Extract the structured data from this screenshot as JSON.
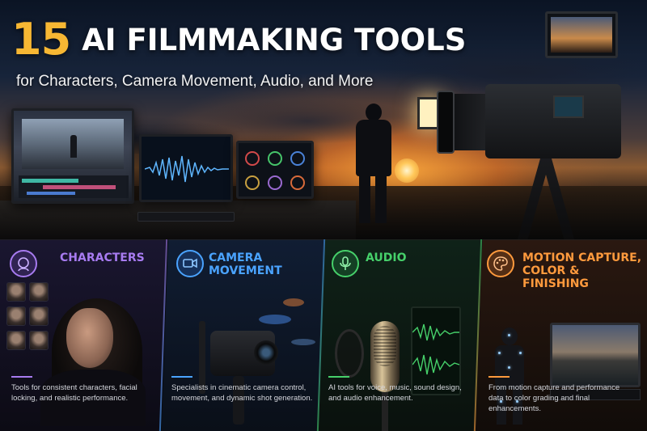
{
  "header": {
    "title_number": "15",
    "title_text": "AI FILMMAKING TOOLS",
    "subtitle": "for Characters, Camera Movement, Audio, and More"
  },
  "colors": {
    "title_number": "#f7b733",
    "characters": "#a77bf0",
    "camera_movement": "#4aa3ff",
    "audio": "#46d06a",
    "motion_capture": "#ff9a3d"
  },
  "panels": [
    {
      "icon": "face-icon",
      "heading_line1": "CHARACTERS",
      "heading_line2": "",
      "description": "Tools for consistent characters, facial locking, and realistic performance."
    },
    {
      "icon": "camera-movement-icon",
      "heading_line1": "CAMERA MOVEMENT",
      "heading_line2": "",
      "description": "Specialists in cinematic camera control, movement, and dynamic shot generation."
    },
    {
      "icon": "microphone-icon",
      "heading_line1": "AUDIO",
      "heading_line2": "",
      "description": "AI tools for voice, music, sound design, and audio enhancement."
    },
    {
      "icon": "palette-brush-icon",
      "heading_line1": "MOTION CAPTURE,",
      "heading_line2": "COLOR & FINISHING",
      "description": "From motion capture and performance data to color grading and final enhancements."
    }
  ]
}
